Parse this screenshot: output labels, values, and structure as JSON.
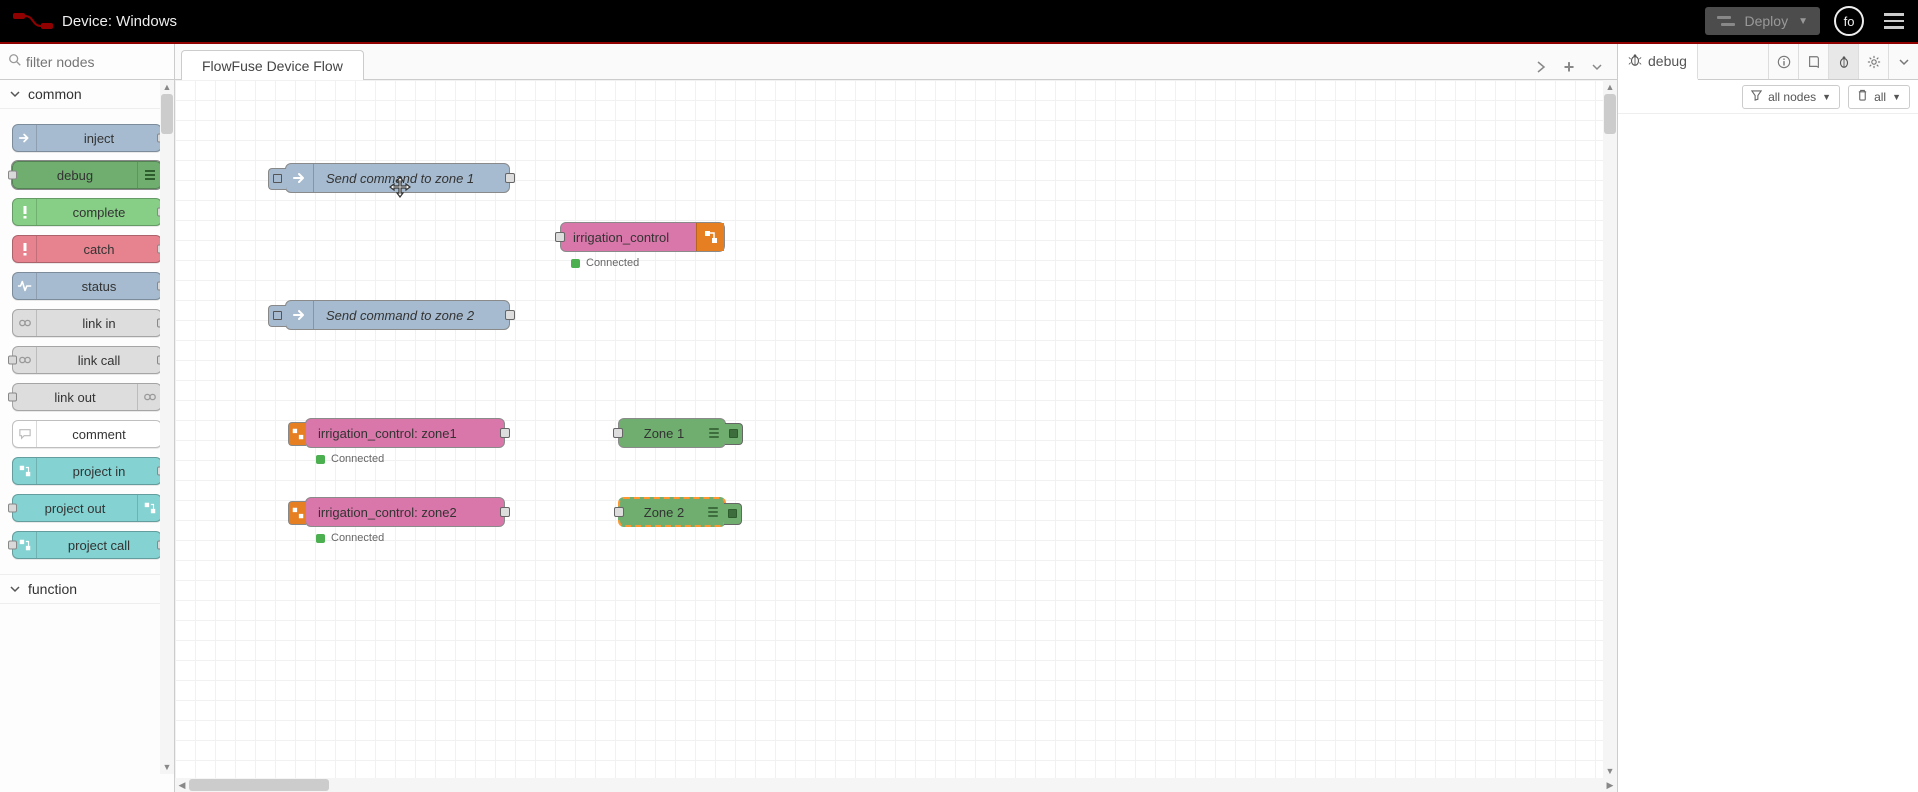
{
  "header": {
    "title": "Device: Windows",
    "deploy_label": "Deploy",
    "user_initials": "fo"
  },
  "palette": {
    "filter_placeholder": "filter nodes",
    "categories": [
      {
        "name": "common",
        "expanded": true
      },
      {
        "name": "function",
        "expanded": false
      }
    ],
    "common_nodes": [
      {
        "label": "inject",
        "color": "c-blue",
        "icon": "arrow-in",
        "port_out": true
      },
      {
        "label": "debug",
        "color": "c-greenD",
        "icon": "bars",
        "icon_right": true,
        "port_in": true,
        "selected": true
      },
      {
        "label": "complete",
        "color": "c-green",
        "icon": "bang",
        "port_out": true
      },
      {
        "label": "catch",
        "color": "c-red",
        "icon": "bang",
        "port_out": true
      },
      {
        "label": "status",
        "color": "c-blue",
        "icon": "pulse",
        "port_out": true
      },
      {
        "label": "link in",
        "color": "c-grey",
        "icon": "link",
        "port_out": true
      },
      {
        "label": "link call",
        "color": "c-grey",
        "icon": "link",
        "port_in": true,
        "port_out": true
      },
      {
        "label": "link out",
        "color": "c-grey",
        "icon": "link",
        "icon_right": true,
        "port_in": true
      },
      {
        "label": "comment",
        "color": "c-white",
        "icon": "comment"
      },
      {
        "label": "project in",
        "color": "c-teal",
        "icon": "plink",
        "port_out": true
      },
      {
        "label": "project out",
        "color": "c-teal",
        "icon": "plink",
        "icon_right": true,
        "port_in": true
      },
      {
        "label": "project call",
        "color": "c-teal",
        "icon": "plink",
        "port_in": true,
        "port_out": true
      }
    ]
  },
  "flow": {
    "tab_name": "FlowFuse Device Flow",
    "nodes": {
      "inject1": {
        "label": "Send command to zone 1"
      },
      "inject2": {
        "label": "Send command to zone 2"
      },
      "irr_main": {
        "label": "irrigation_control",
        "status": "Connected"
      },
      "irr_z1": {
        "label": "irrigation_control: zone1",
        "status": "Connected"
      },
      "irr_z2": {
        "label": "irrigation_control: zone2",
        "status": "Connected"
      },
      "dbg_z1": {
        "label": "Zone 1"
      },
      "dbg_z2": {
        "label": "Zone 2"
      }
    }
  },
  "sidebar": {
    "tab_label": "debug",
    "filter_label": "all nodes",
    "clear_label": "all"
  }
}
